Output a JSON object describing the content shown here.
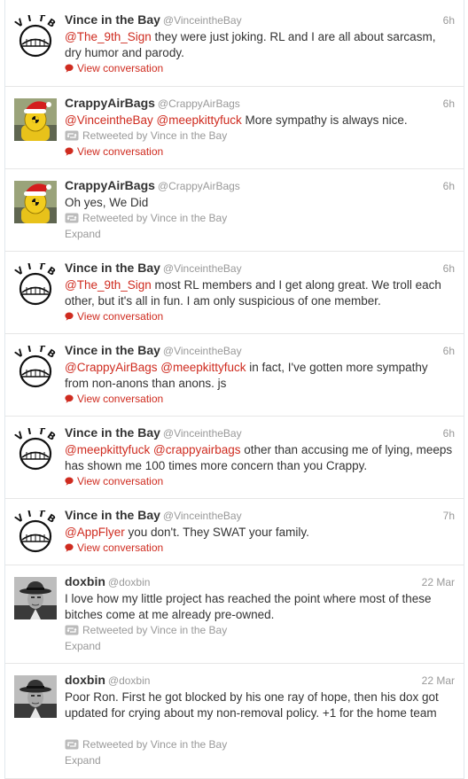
{
  "tweets": [
    {
      "name": "Vince in the Bay",
      "handle": "@VinceintheBay",
      "time": "6h",
      "segments": [
        {
          "t": "@The_9th_Sign",
          "m": true
        },
        {
          "t": " they were just joking. RL and I are all about sarcasm, dry humor and parody.",
          "m": false
        }
      ],
      "retweet": "",
      "action": "View conversation",
      "avatar": "vitb"
    },
    {
      "name": "CrappyAirBags",
      "handle": "@CrappyAirBags",
      "time": "6h",
      "segments": [
        {
          "t": "@VinceintheBay",
          "m": true
        },
        {
          "t": " ",
          "m": false
        },
        {
          "t": "@meepkittyfuck",
          "m": true
        },
        {
          "t": " More sympathy is always nice.",
          "m": false
        }
      ],
      "retweet": "Retweeted by Vince in the Bay",
      "action": "View conversation",
      "avatar": "crash"
    },
    {
      "name": "CrappyAirBags",
      "handle": "@CrappyAirBags",
      "time": "6h",
      "segments": [
        {
          "t": "Oh yes, We Did",
          "m": false
        }
      ],
      "retweet": "Retweeted by Vince in the Bay",
      "action": "Expand",
      "avatar": "crash"
    },
    {
      "name": "Vince in the Bay",
      "handle": "@VinceintheBay",
      "time": "6h",
      "segments": [
        {
          "t": "@The_9th_Sign",
          "m": true
        },
        {
          "t": " most RL members and I get along great. We troll each other, but it's all in fun. I am only suspicious of one member.",
          "m": false
        }
      ],
      "retweet": "",
      "action": "View conversation",
      "avatar": "vitb"
    },
    {
      "name": "Vince in the Bay",
      "handle": "@VinceintheBay",
      "time": "6h",
      "segments": [
        {
          "t": "@CrappyAirBags",
          "m": true
        },
        {
          "t": " ",
          "m": false
        },
        {
          "t": "@meepkittyfuck",
          "m": true
        },
        {
          "t": " in fact, I've gotten more sympathy from non-anons than anons. js",
          "m": false
        }
      ],
      "retweet": "",
      "action": "View conversation",
      "avatar": "vitb"
    },
    {
      "name": "Vince in the Bay",
      "handle": "@VinceintheBay",
      "time": "6h",
      "segments": [
        {
          "t": "@meepkittyfuck",
          "m": true
        },
        {
          "t": " ",
          "m": false
        },
        {
          "t": "@crappyairbags",
          "m": true
        },
        {
          "t": " other than accusing me of lying, meeps has shown me 100 times more concern than you Crappy.",
          "m": false
        }
      ],
      "retweet": "",
      "action": "View conversation",
      "avatar": "vitb"
    },
    {
      "name": "Vince in the Bay",
      "handle": "@VinceintheBay",
      "time": "7h",
      "segments": [
        {
          "t": "@AppFlyer",
          "m": true
        },
        {
          "t": " you don't. They SWAT your family.",
          "m": false
        }
      ],
      "retweet": "",
      "action": "View conversation",
      "avatar": "vitb"
    },
    {
      "name": "doxbin",
      "handle": "@doxbin",
      "time": "22 Mar",
      "segments": [
        {
          "t": "I love how my little project has reached the point where most of these bitches come at me already pre-owned.",
          "m": false
        }
      ],
      "retweet": "Retweeted by Vince in the Bay",
      "action": "Expand",
      "avatar": "fedora"
    },
    {
      "name": "doxbin",
      "handle": "@doxbin",
      "time": "22 Mar",
      "segments": [
        {
          "t": "Poor Ron. First he got blocked by his one ray of hope, then his dox got updated for crying about my non-removal policy. +1 for the home team",
          "m": false
        }
      ],
      "retweet": "Retweeted by Vince in the Bay",
      "action": "Expand",
      "avatar": "fedora"
    }
  ],
  "avatar_logo_text": "VITB",
  "colors": {
    "mention": "#cf2b1f",
    "name": "#333333",
    "muted": "#999999",
    "border": "#e6e6e6"
  }
}
